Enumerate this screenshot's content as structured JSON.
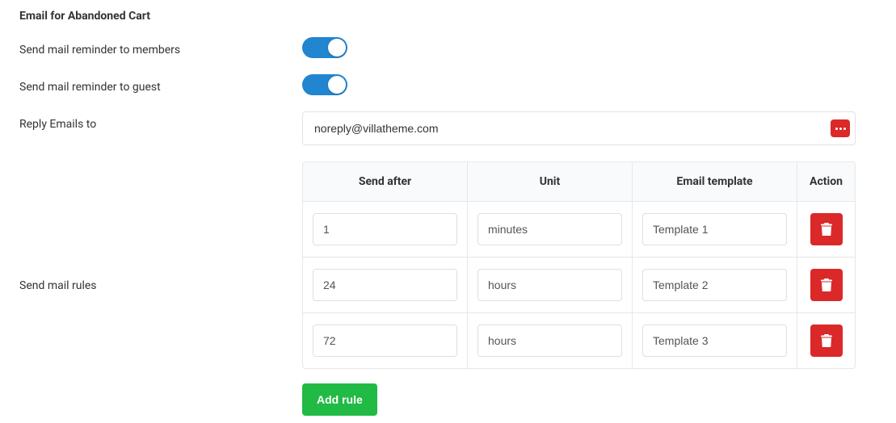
{
  "section_title": "Email for Abandoned Cart",
  "reminder_members": {
    "label": "Send mail reminder to members",
    "on": true
  },
  "reminder_guest": {
    "label": "Send mail reminder to guest",
    "on": true
  },
  "reply_to": {
    "label": "Reply Emails to",
    "value": "noreply@villatheme.com"
  },
  "rules": {
    "label": "Send mail rules",
    "headers": {
      "after": "Send after",
      "unit": "Unit",
      "template": "Email template",
      "action": "Action"
    },
    "rows": [
      {
        "after": "1",
        "unit": "minutes",
        "template": "Template 1"
      },
      {
        "after": "24",
        "unit": "hours",
        "template": "Template 2"
      },
      {
        "after": "72",
        "unit": "hours",
        "template": "Template 3"
      }
    ],
    "add_button": "Add rule"
  }
}
